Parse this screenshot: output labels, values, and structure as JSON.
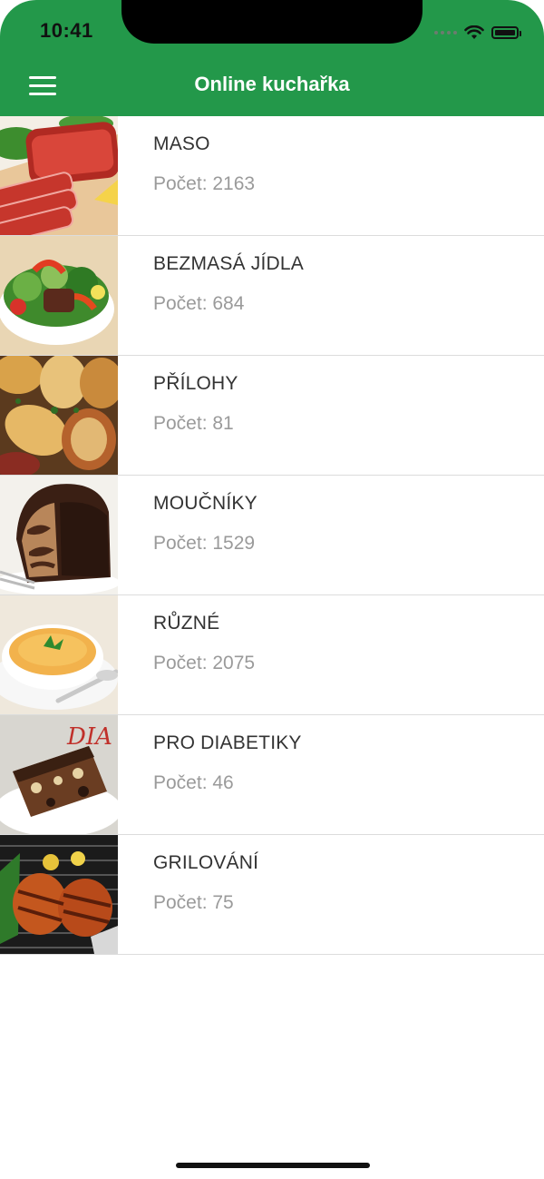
{
  "status_bar": {
    "time": "10:41"
  },
  "header": {
    "title": "Online kuchařka",
    "menu_icon": "hamburger-menu-icon",
    "color": "#23984a"
  },
  "categories": [
    {
      "name": "MASO",
      "count": "Počet: 2163",
      "image": "meat-photo"
    },
    {
      "name": "BEZMASÁ JÍDLA",
      "count": "Počet: 684",
      "image": "salad-photo"
    },
    {
      "name": "PŘÍLOHY",
      "count": "Počet: 81",
      "image": "potatoes-photo"
    },
    {
      "name": "MOUČNÍKY",
      "count": "Počet: 1529",
      "image": "cake-photo"
    },
    {
      "name": "RŮZNÉ",
      "count": "Počet: 2075",
      "image": "soup-photo"
    },
    {
      "name": "PRO DIABETIKY",
      "count": "Počet: 46",
      "image": "diabetic-cake-photo",
      "image_text": "DIA"
    },
    {
      "name": "GRILOVÁNÍ",
      "count": "Počet: 75",
      "image": "grill-photo"
    }
  ]
}
